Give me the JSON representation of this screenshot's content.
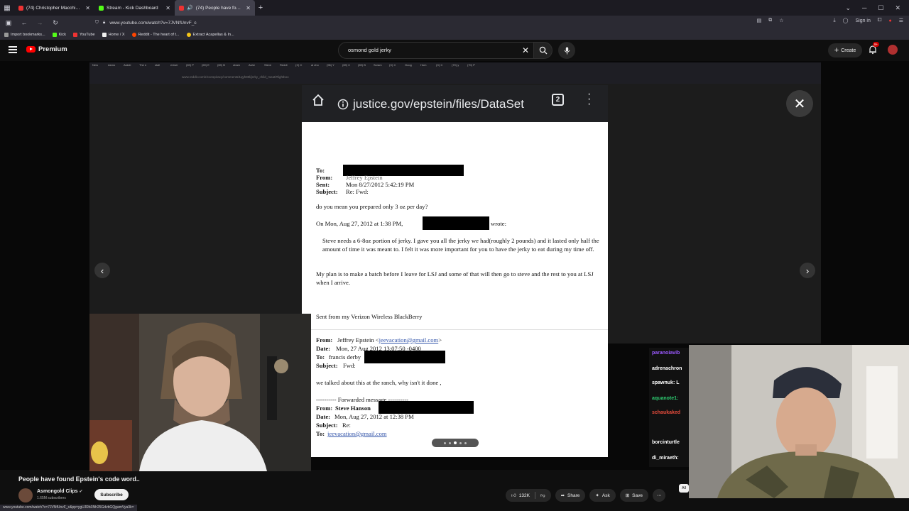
{
  "browser": {
    "tabs": [
      {
        "title": "(74) Christopher Macchio's \"A...",
        "color": "#e33"
      },
      {
        "title": "Stream - Kick Dashboard",
        "color": "#53fc18"
      },
      {
        "title": "(74) People have found Ep...",
        "color": "#e33"
      }
    ],
    "url": "www.youtube.com/watch?v=7JVNfUnvF_c",
    "sign_in": "Sign in",
    "bookmarks": [
      {
        "label": "Import bookmarks...",
        "color": "#999"
      },
      {
        "label": "Kick",
        "color": "#53fc18"
      },
      {
        "label": "YouTube",
        "color": "#e33"
      },
      {
        "label": "Home / X",
        "color": "#eee"
      },
      {
        "label": "Reddit - The heart of t...",
        "color": "#ff4500"
      },
      {
        "label": "Extract Acapellas & In...",
        "color": "#f5c518"
      }
    ]
  },
  "youtube": {
    "brand": "Premium",
    "search_query": "osmond gold jerky",
    "create_label": "Create",
    "notif_count": "9+"
  },
  "inner_browser": {
    "url": "www.reddit.com/r/conspiracy/comments/1qyh90l/jerky_child_meat/#lightbox",
    "tab_labels": [
      "New",
      "Asmo",
      "AskAI",
      "The n",
      "stall",
      "eUser",
      "(69) P",
      "(69) E",
      "(69) B",
      "obam",
      "Ashe",
      "Steve",
      "Reddi",
      "(X) C",
      "ai cho",
      "(96) Y",
      "(69) C",
      "(69) B",
      "Scram",
      "(X) C",
      "Goog",
      "Hom",
      "(X) C",
      "(70) y",
      "(70) P"
    ]
  },
  "phone": {
    "site": "justice.gov/epstein/files/DataSet",
    "tab_count": "2"
  },
  "document": {
    "header": {
      "to_label": "To:",
      "from_label": "From:",
      "from_value": "Jeffrey Epstein",
      "sent_label": "Sent:",
      "sent_value": "Mon 8/27/2012 5:42:19 PM",
      "subject_label": "Subject:",
      "subject_value": "Re: Fwd:"
    },
    "line1": "do you mean you prepared  only 3 oz  per day?",
    "on_line_prefix": "On Mon, Aug 27, 2012 at 1:38 PM,",
    "on_line_suffix": "wrote:",
    "quote1": "Steve needs a 6-8oz portion of jerky. I gave you all the jerky we had(roughly 2 pounds) and it lasted only half the amount of time it was meant to. I felt it was more important for you to have the jerky to eat during my time off.",
    "quote2": "My plan is to make a batch before I leave for LSJ and some of that will then go to steve and the rest to you at LSJ when I arrive.",
    "signature": "Sent from my Verizon Wireless BlackBerry",
    "fwd": {
      "from_label": "From:",
      "from_value": "Jeffrey Epstein <",
      "from_email": "jeevacation@gmail.com",
      "from_close": ">",
      "date_label": "Date:",
      "date_value": "Mon, 27 Aug 2012 13:07:50 -0400",
      "to_label": "To:",
      "to_value": "francis derby",
      "subject_label": "Subject:",
      "subject_value": "Fwd:",
      "body": "we talked about this at the ranch, why isn't it done ,",
      "forwarded": "---------- Forwarded message ----------",
      "from2_label": "From:",
      "from2_value": "Steve Hanson",
      "date2_label": "Date:",
      "date2_value": "Mon, Aug 27, 2012 at 12:38 PM",
      "subject2_label": "Subject:",
      "subject2_value": "Re:",
      "to2_label": "To:",
      "to2_value": "jeevacation@gmail.com"
    }
  },
  "chat": [
    {
      "user": "paranoiavib",
      "color": "#9b59ff"
    },
    {
      "user": "adrenachron",
      "color": "#ffffff"
    },
    {
      "user": "spawnuk: L",
      "color": "#ffffff"
    },
    {
      "user": "aquanote1:",
      "color": "#2ecc71"
    },
    {
      "user": "schaukaked",
      "color": "#e74c3c"
    },
    {
      "user": "borcinturtle",
      "color": "#ffffff"
    },
    {
      "user": "di_miraeth:",
      "color": "#ffffff"
    }
  ],
  "video": {
    "title": "People have found Epstein's code word..",
    "channel": "Asmongold Clips",
    "subscribers": "1.65M subscribers",
    "subscribe": "Subscribe",
    "likes": "132K",
    "share": "Share",
    "ask": "Ask",
    "save": "Save",
    "chip_all": "All"
  },
  "status_url": "www.youtube.com/watch?v=7JVNfUnvF_c&pp=ygUJRb3Nh25GdvbGQgamVya3k="
}
